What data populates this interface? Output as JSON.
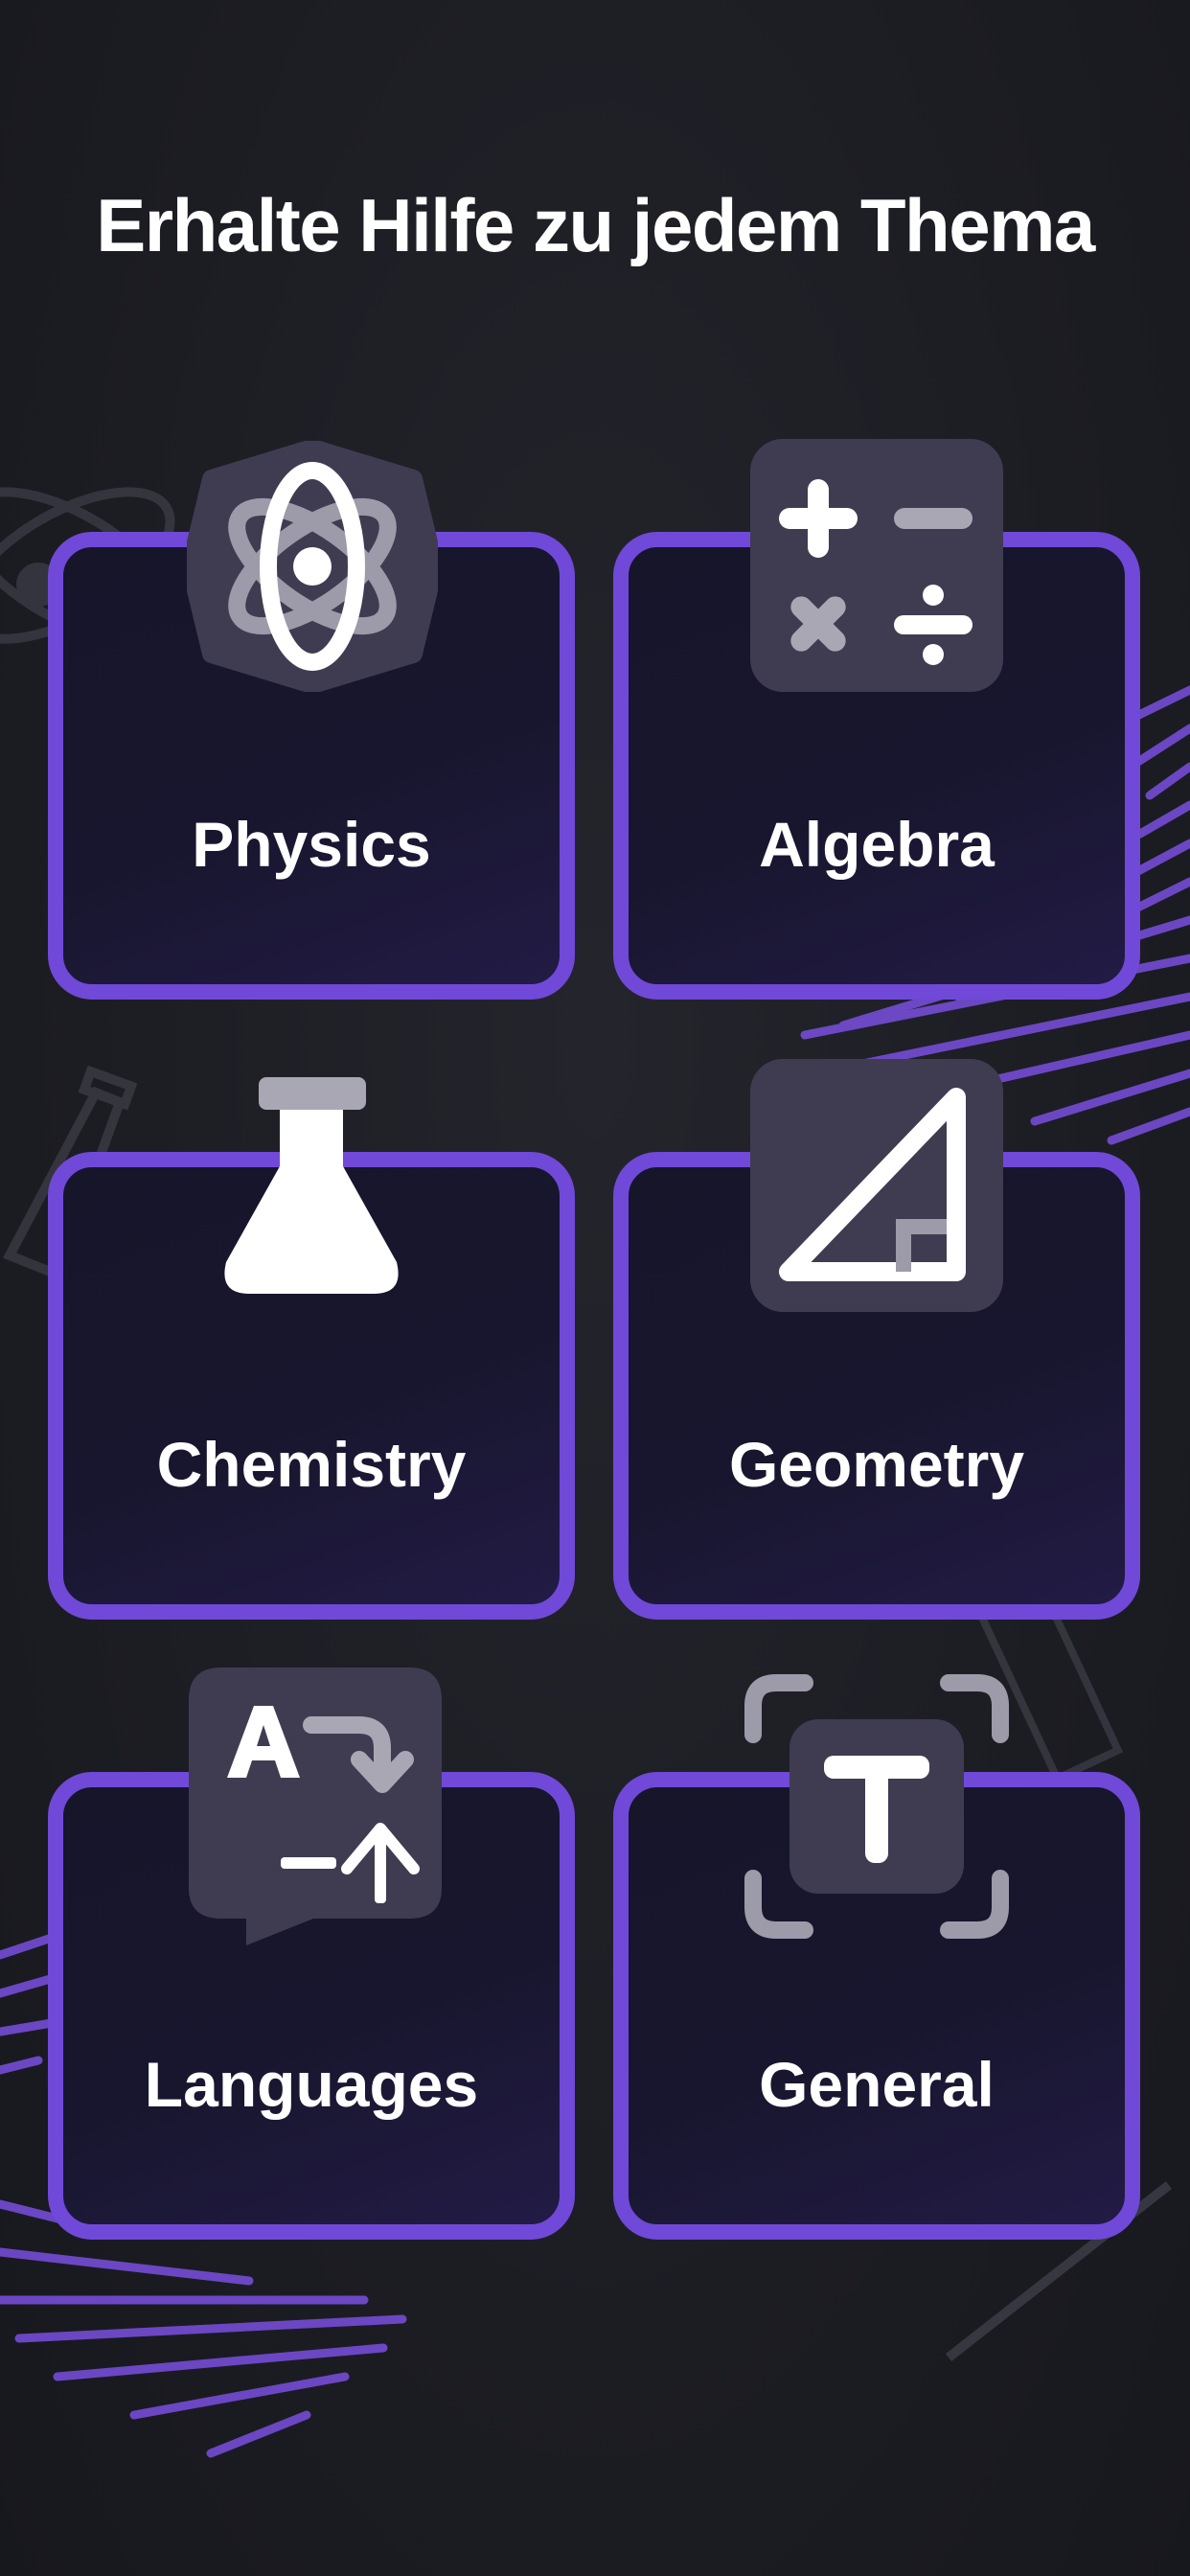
{
  "page": {
    "title": "Erhalte Hilfe zu jedem Thema"
  },
  "subjects": [
    {
      "label": "Physics",
      "icon": "atom-icon"
    },
    {
      "label": "Algebra",
      "icon": "calculator-operators-icon"
    },
    {
      "label": "Chemistry",
      "icon": "flask-icon"
    },
    {
      "label": "Geometry",
      "icon": "triangle-ruler-icon"
    },
    {
      "label": "Languages",
      "icon": "translate-icon"
    },
    {
      "label": "General",
      "icon": "text-scan-icon"
    }
  ],
  "colors": {
    "background": "#1c1d23",
    "card_border": "#7049d8",
    "card_fill": "#18162e",
    "icon_tile": "#3f3c52",
    "accent_scribble": "#7a4fe0",
    "text": "#ffffff"
  }
}
